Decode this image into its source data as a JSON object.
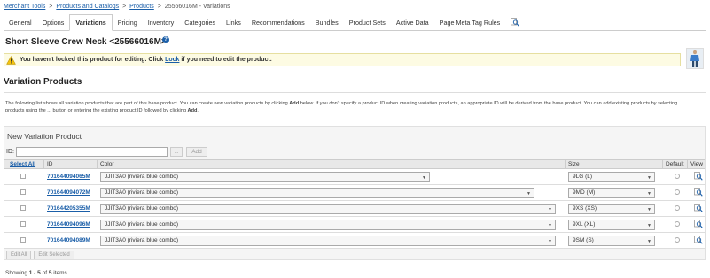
{
  "breadcrumb": {
    "items": [
      "Merchant Tools",
      "Products and Catalogs",
      "Products"
    ],
    "separator": ">",
    "current": "25566016M - Variations"
  },
  "tabs": [
    "General",
    "Options",
    "Variations",
    "Pricing",
    "Inventory",
    "Categories",
    "Links",
    "Recommendations",
    "Bundles",
    "Product Sets",
    "Active Data",
    "Page Meta Tag Rules"
  ],
  "active_tab": "Variations",
  "product": {
    "title": "Short Sleeve Crew Neck <25566016M>",
    "help_icon": "?"
  },
  "notice": {
    "text_before": "You haven't locked this product for editing. Click ",
    "link": "Lock",
    "text_after": " if you need to edit the product."
  },
  "variations": {
    "title": "Variation Products",
    "description_1": "The following list shows all variation products that are part of this base product. You can create new variation products by clicking ",
    "description_add": "Add",
    "description_2": " below. If you don't specify a product ID when creating variation products, an appropriate ID will be derived from the base product. You can add existing products by selecting products using the ",
    "description_dots": "...",
    "description_3": " button or entering the existing product ID followed by clicking ",
    "description_add2": "Add",
    "description_end": "."
  },
  "new_variation": {
    "title": "New Variation Product",
    "id_label": "ID:",
    "id_value": "",
    "dots_label": "...",
    "add_label": "Add"
  },
  "table": {
    "headers": {
      "select_all": "Select All",
      "id": "ID",
      "color": "Color",
      "size": "Size",
      "default": "Default",
      "view": "View"
    },
    "rows": [
      {
        "id": "701644094065M",
        "color": "JJIT3A0 (riviera blue combo)",
        "size": "9LG (L)"
      },
      {
        "id": "701644094072M",
        "color": "JJIT3A0 (riviera blue combo)",
        "size": "9MD (M)"
      },
      {
        "id": "701644205355M",
        "color": "JJIT3A0 (riviera blue combo)",
        "size": "9XS (XS)"
      },
      {
        "id": "701644094096M",
        "color": "JJIT3A0 (riviera blue combo)",
        "size": "9XL (XL)"
      },
      {
        "id": "701644094089M",
        "color": "JJIT3A0 (riviera blue combo)",
        "size": "9SM (S)"
      }
    ]
  },
  "footer_buttons": {
    "edit_all": "Edit All",
    "edit_selected": "Edit Selected"
  },
  "pagination": {
    "prefix": "Showing ",
    "start": "1",
    "dash": " - ",
    "end": "5",
    "of": " of ",
    "total": "5",
    "suffix": " items"
  },
  "colors": {
    "link": "#1a5ea8",
    "notice_bg": "#fdfbe3",
    "panel_bg": "#f5f5f5"
  }
}
